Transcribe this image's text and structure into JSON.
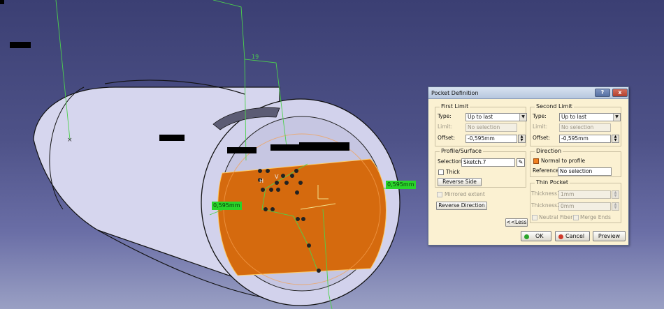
{
  "viewport": {
    "dimension_19": "19",
    "dim_left": "0,595mm",
    "dim_right": "0,595mm",
    "sketch_h": "H",
    "sketch_v": "V"
  },
  "dialog": {
    "title": "Pocket Definition",
    "help_label": "?",
    "close_label": "x",
    "first_limit": {
      "title": "First Limit",
      "type_label": "Type:",
      "type_value": "Up to last",
      "limit_label": "Limit:",
      "limit_value": "No selection",
      "offset_label": "Offset:",
      "offset_value": "-0,595mm"
    },
    "profile": {
      "title": "Profile/Surface",
      "selection_label": "Selection:",
      "selection_value": "Sketch.7",
      "thick_label": "Thick",
      "reverse_side_label": "Reverse Side"
    },
    "mirrored_label": "Mirrored extent",
    "reverse_direction_label": "Reverse Direction",
    "second_limit": {
      "title": "Second Limit",
      "type_label": "Type:",
      "type_value": "Up to last",
      "limit_label": "Limit:",
      "limit_value": "No selection",
      "offset_label": "Offset:",
      "offset_value": "-0,595mm"
    },
    "direction": {
      "title": "Direction",
      "normal_label": "Normal to profile",
      "reference_label": "Reference:",
      "reference_value": "No selection"
    },
    "thin_pocket": {
      "title": "Thin Pocket",
      "thickness1_label": "Thickness1:",
      "thickness1_value": "1mm",
      "thickness2_label": "Thickness2:",
      "thickness2_value": "0mm",
      "neutral_label": "Neutral Fiber",
      "merge_label": "Merge Ends"
    },
    "less_label": "<<Less",
    "ok_label": "OK",
    "cancel_label": "Cancel",
    "preview_label": "Preview"
  }
}
